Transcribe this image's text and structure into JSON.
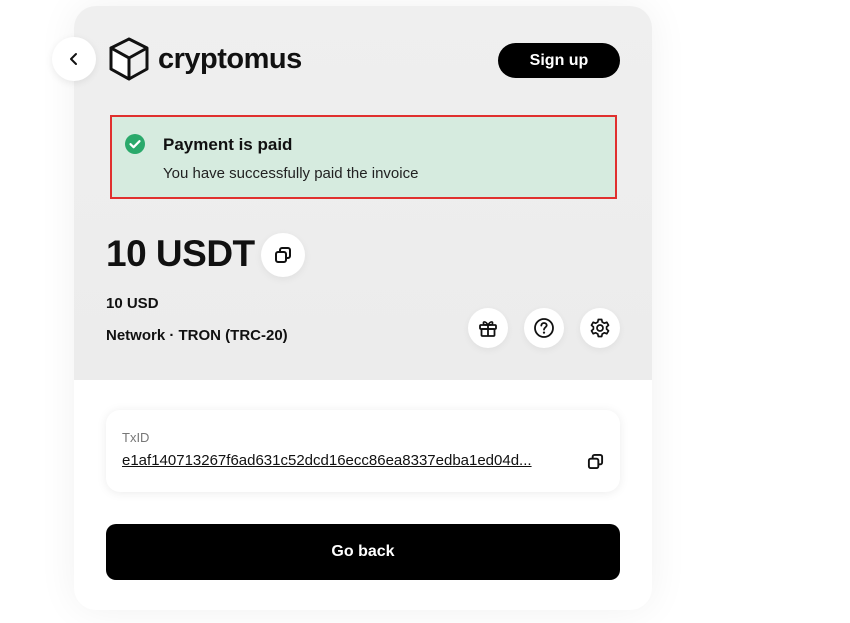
{
  "header": {
    "brand": "cryptomus",
    "signup_label": "Sign up"
  },
  "alert": {
    "title": "Payment is paid",
    "message": "You have successfully paid the invoice",
    "status_color": "#2aa96b",
    "background_color": "#d6ebdf",
    "border_color": "#e0302e"
  },
  "payment": {
    "amount": "10 USDT",
    "fiat_amount": "10 USD",
    "network": "Network · TRON (TRC-20)"
  },
  "icons": [
    "back-icon",
    "cube-logo-icon",
    "copy-icon",
    "gift-icon",
    "help-icon",
    "settings-icon",
    "check-icon"
  ],
  "transaction": {
    "label": "TxID",
    "value": "e1af140713267f6ad631c52dcd16ecc86ea8337edba1ed04d..."
  },
  "footer": {
    "go_back_label": "Go back"
  }
}
